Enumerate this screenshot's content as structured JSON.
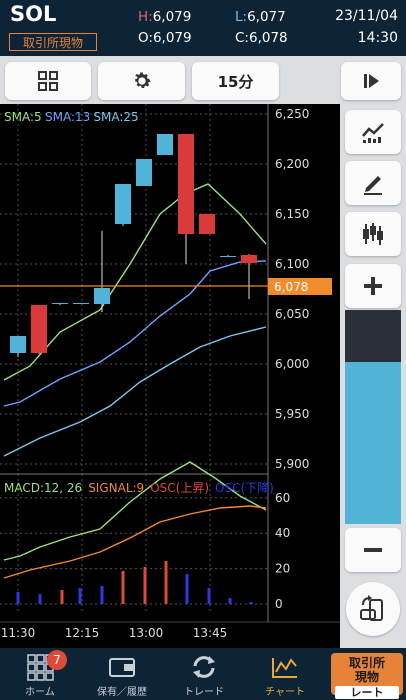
{
  "header": {
    "symbol": "SOL",
    "venue_badge": "取引所現物",
    "high_key": "H:",
    "high": "6,079",
    "low_key": "L:",
    "low": "6,077",
    "open_key": "O:",
    "open": "6,079",
    "close_key": "C:",
    "close": "6,078",
    "date": "23/11/04",
    "time": "14:30"
  },
  "toolbar": {
    "interval_label": "15分"
  },
  "chart": {
    "sma_labels": [
      {
        "text": "SMA:5",
        "color": "#9be37a"
      },
      {
        "text": "SMA:13",
        "color": "#6fa2ff"
      },
      {
        "text": "SMA:25",
        "color": "#7fc7ea"
      }
    ],
    "macd_labels": [
      {
        "text": "MACD:12, 26",
        "color": "#9be37a"
      },
      {
        "text": "SIGNAL:9",
        "color": "#f28a2e"
      },
      {
        "text": "OSC(上昇)",
        "color": "#e04a3a"
      },
      {
        "text": "OSC(下降)",
        "color": "#2a3adf"
      }
    ],
    "current_price_label": "6,078",
    "colors": {
      "up": "#52b3d9",
      "down": "#d93a3a",
      "price_line": "#f28a2e"
    }
  },
  "chart_data": {
    "type": "candlestick",
    "price_axis": {
      "ticks": [
        "6,250",
        "6,200",
        "6,150",
        "6,100",
        "6,050",
        "6,000",
        "5,950",
        "5,900"
      ],
      "ylim": [
        5890,
        6260
      ]
    },
    "macd_axis": {
      "ticks": [
        "60",
        "40",
        "20",
        "0"
      ]
    },
    "time_ticks": [
      "11:30",
      "12:15",
      "13:00",
      "13:45"
    ],
    "candles": [
      {
        "o": 6011,
        "h": 6027,
        "l": 6007,
        "c": 6028
      },
      {
        "o": 6059,
        "h": 6059,
        "l": 6010,
        "c": 6011
      },
      {
        "o": 6060,
        "h": 6061,
        "l": 6059,
        "c": 6061
      },
      {
        "o": 6061,
        "h": 6061,
        "l": 6060,
        "c": 6061
      },
      {
        "o": 6060,
        "h": 6133,
        "l": 6052,
        "c": 6076
      },
      {
        "o": 6140,
        "h": 6141,
        "l": 6138,
        "c": 6180
      },
      {
        "o": 6178,
        "h": 6205,
        "l": 6180,
        "c": 6205
      },
      {
        "o": 6209,
        "h": 6230,
        "l": 6209,
        "c": 6230
      },
      {
        "o": 6230,
        "h": 6230,
        "l": 6100,
        "c": 6130
      },
      {
        "o": 6150,
        "h": 6150,
        "l": 6130,
        "c": 6130
      },
      {
        "o": 6108,
        "h": 6109,
        "l": 6108,
        "c": 6108
      },
      {
        "o": 6109,
        "h": 6110,
        "l": 6065,
        "c": 6101
      }
    ],
    "current_price": 6078
  },
  "nav": {
    "home_label": "ホーム",
    "home_badge": "7",
    "holdings_label": "保有／履歴",
    "trade_label": "トレード",
    "chart_label": "チャート",
    "venue_label": "取引所\n現物",
    "venue_sub": "レート"
  }
}
